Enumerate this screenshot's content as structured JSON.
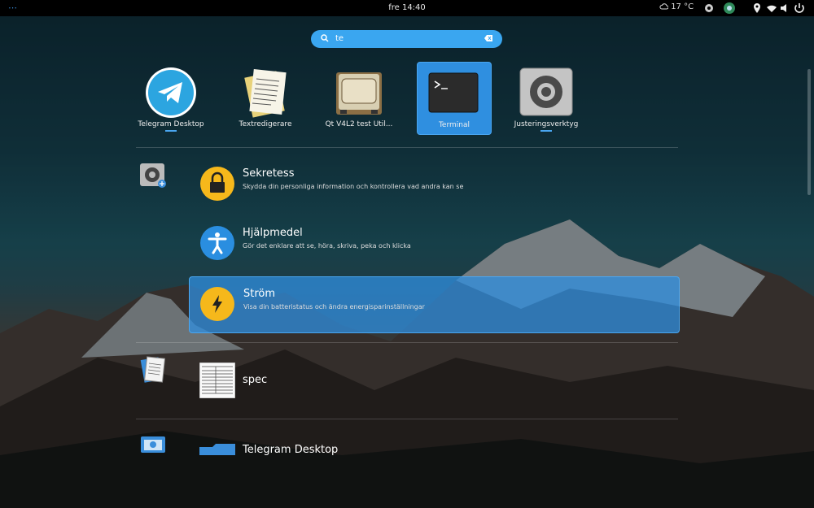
{
  "topbar": {
    "activities_label": "⋯",
    "clock": "fre 14:40",
    "weather": "17 °C"
  },
  "search": {
    "value": "te"
  },
  "apps": [
    {
      "label": "Telegram Desktop",
      "icon": "telegram-icon"
    },
    {
      "label": "Textredigerare",
      "icon": "text-editor-icon"
    },
    {
      "label": "Qt V4L2 test Util...",
      "icon": "webcam-icon"
    },
    {
      "label": "Terminal",
      "icon": "terminal-icon"
    },
    {
      "label": "Justeringsverktyg",
      "icon": "tweaks-icon"
    }
  ],
  "settings_results": [
    {
      "title": "Sekretess",
      "desc": "Skydda din personliga information och kontrollera vad andra kan se",
      "icon": "lock-icon"
    },
    {
      "title": "Hjälpmedel",
      "desc": "Gör det enklare att se, höra, skriva, peka och klicka",
      "icon": "accessibility-icon"
    },
    {
      "title": "Ström",
      "desc": "Visa din batteristatus och ändra energisparinställningar",
      "icon": "power-icon"
    }
  ],
  "document_results": [
    {
      "title": "spec",
      "icon": "document-thumbnail-icon"
    }
  ],
  "files_results": [
    {
      "title": "Telegram Desktop",
      "icon": "folder-icon"
    }
  ],
  "colors": {
    "accent": "#3aa6f0",
    "topbar": "#000000"
  }
}
